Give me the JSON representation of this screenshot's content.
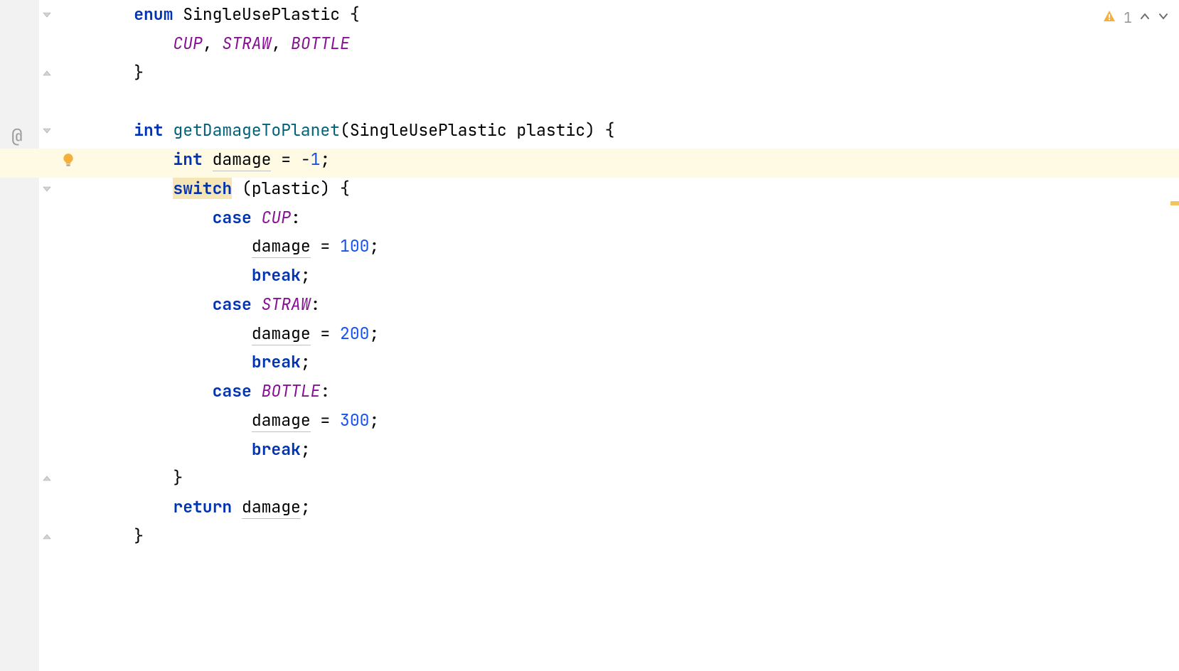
{
  "inspection": {
    "warn_count": "1"
  },
  "code": {
    "lines": [
      {
        "indent": 1,
        "segments": [
          {
            "t": "enum ",
            "c": "kw"
          },
          {
            "t": "SingleUsePlastic",
            "c": "type"
          },
          {
            "t": " {",
            "c": "punct"
          }
        ]
      },
      {
        "indent": 2,
        "segments": [
          {
            "t": "CUP",
            "c": "enum-const"
          },
          {
            "t": ", ",
            "c": "punct"
          },
          {
            "t": "STRAW",
            "c": "enum-const"
          },
          {
            "t": ", ",
            "c": "punct"
          },
          {
            "t": "BOTTLE",
            "c": "enum-const"
          }
        ]
      },
      {
        "indent": 1,
        "segments": [
          {
            "t": "}",
            "c": "punct"
          }
        ]
      },
      {
        "indent": 0,
        "segments": []
      },
      {
        "indent": 1,
        "segments": [
          {
            "t": "int ",
            "c": "kw"
          },
          {
            "t": "getDamageToPlanet",
            "c": "method"
          },
          {
            "t": "(",
            "c": "paren"
          },
          {
            "t": "SingleUsePlastic plastic",
            "c": "ident"
          },
          {
            "t": ") {",
            "c": "punct"
          }
        ]
      },
      {
        "indent": 2,
        "highlighted": true,
        "segments": [
          {
            "t": "int ",
            "c": "kw"
          },
          {
            "t": "damage",
            "c": "ident var-under"
          },
          {
            "t": " = ",
            "c": "punct"
          },
          {
            "t": "-",
            "c": "punct"
          },
          {
            "t": "1",
            "c": "num"
          },
          {
            "t": ";",
            "c": "punct"
          }
        ]
      },
      {
        "indent": 2,
        "segments": [
          {
            "t": "switch",
            "c": "kw switch-hl"
          },
          {
            "t": " (plastic) {",
            "c": "punct"
          }
        ]
      },
      {
        "indent": 3,
        "segments": [
          {
            "t": "case ",
            "c": "kw"
          },
          {
            "t": "CUP",
            "c": "enum-const"
          },
          {
            "t": ":",
            "c": "punct"
          }
        ]
      },
      {
        "indent": 4,
        "segments": [
          {
            "t": "damage",
            "c": "ident var-under"
          },
          {
            "t": " = ",
            "c": "punct"
          },
          {
            "t": "100",
            "c": "num"
          },
          {
            "t": ";",
            "c": "punct"
          }
        ]
      },
      {
        "indent": 4,
        "segments": [
          {
            "t": "break",
            "c": "kw"
          },
          {
            "t": ";",
            "c": "punct"
          }
        ]
      },
      {
        "indent": 3,
        "segments": [
          {
            "t": "case ",
            "c": "kw"
          },
          {
            "t": "STRAW",
            "c": "enum-const"
          },
          {
            "t": ":",
            "c": "punct"
          }
        ]
      },
      {
        "indent": 4,
        "segments": [
          {
            "t": "damage",
            "c": "ident var-under"
          },
          {
            "t": " = ",
            "c": "punct"
          },
          {
            "t": "200",
            "c": "num"
          },
          {
            "t": ";",
            "c": "punct"
          }
        ]
      },
      {
        "indent": 4,
        "segments": [
          {
            "t": "break",
            "c": "kw"
          },
          {
            "t": ";",
            "c": "punct"
          }
        ]
      },
      {
        "indent": 3,
        "segments": [
          {
            "t": "case ",
            "c": "kw"
          },
          {
            "t": "BOTTLE",
            "c": "enum-const"
          },
          {
            "t": ":",
            "c": "punct"
          }
        ]
      },
      {
        "indent": 4,
        "segments": [
          {
            "t": "damage",
            "c": "ident var-under"
          },
          {
            "t": " = ",
            "c": "punct"
          },
          {
            "t": "300",
            "c": "num"
          },
          {
            "t": ";",
            "c": "punct"
          }
        ]
      },
      {
        "indent": 4,
        "segments": [
          {
            "t": "break",
            "c": "kw"
          },
          {
            "t": ";",
            "c": "punct"
          }
        ]
      },
      {
        "indent": 2,
        "segments": [
          {
            "t": "}",
            "c": "punct"
          }
        ]
      },
      {
        "indent": 2,
        "segments": [
          {
            "t": "return ",
            "c": "kw"
          },
          {
            "t": "damage",
            "c": "ident var-under"
          },
          {
            "t": ";",
            "c": "punct"
          }
        ]
      },
      {
        "indent": 1,
        "segments": [
          {
            "t": "}",
            "c": "punct"
          }
        ]
      }
    ]
  },
  "fold_markers": [
    {
      "line": 0,
      "type": "expand"
    },
    {
      "line": 2,
      "type": "collapse"
    },
    {
      "line": 4,
      "type": "expand"
    },
    {
      "line": 6,
      "type": "expand"
    },
    {
      "line": 16,
      "type": "collapse"
    },
    {
      "line": 18,
      "type": "collapse"
    }
  ]
}
